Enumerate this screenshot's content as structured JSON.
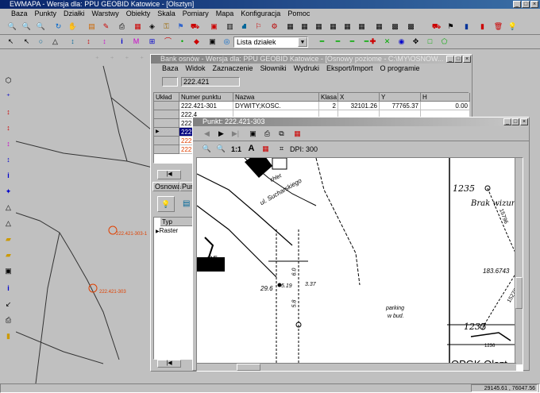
{
  "app": {
    "title": "EWMAPA - Wersja dla: PPU GEOBID Katowice - [Olsztyn]",
    "menu": [
      "Baza",
      "Punkty",
      "Działki",
      "Warstwy",
      "Obiekty",
      "Skala",
      "Pomiary",
      "Mapa",
      "Konfiguracja",
      "Pomoc"
    ],
    "layer_select": "Lista działek",
    "status_coords": "29145.61 , 76047.56"
  },
  "bank": {
    "title": "Bank osnów - Wersja dla: PPU GEOBID Katowice - [Osnowy poziome - C:\\MY\\OSNOW...",
    "menu": [
      "Baza",
      "Widok",
      "Zaznaczenie",
      "Słowniki",
      "Wydruki",
      "Eksport/Import",
      "O programie"
    ],
    "search_value": "222.421",
    "columns": [
      "Układ",
      "Numer punktu",
      "Nazwa",
      "Klasa",
      "X",
      "Y",
      "H"
    ],
    "rows": [
      {
        "num": "222.421-301",
        "name": "DYWITY;KOSC.",
        "klasa": "2",
        "x": "32101.26",
        "y": "77765.37",
        "h": "0.00"
      },
      {
        "num": "222.4",
        "name": "",
        "klasa": "",
        "x": "",
        "y": "",
        "h": ""
      },
      {
        "num": "222.4",
        "name": "",
        "klasa": "",
        "x": "",
        "y": "",
        "h": ""
      },
      {
        "num": "222.4",
        "name": "",
        "klasa": "",
        "x": "",
        "y": "",
        "h": ""
      },
      {
        "num": "222.4",
        "name": "",
        "klasa": "",
        "x": "",
        "y": "",
        "h": ""
      },
      {
        "num": "222.4",
        "name": "",
        "klasa": "",
        "x": "",
        "y": "",
        "h": ""
      }
    ],
    "tabs": [
      "Osnowa",
      "Pun"
    ],
    "sub_columns": [
      "Typ"
    ],
    "sub_rows": [
      "Raster"
    ]
  },
  "punkt": {
    "title": "Punkt: 222.421-303",
    "zoom_label": "1:1",
    "dpi": "DPI: 300",
    "scan_labels": {
      "s1235": "1235",
      "brak": "Brak wizur",
      "s1237": "1237",
      "opgk": "OPGK Olszt",
      "sucharskiego": "ul. Sucharskiego",
      "chlet": "chlet",
      "num05": "05",
      "v296": "29.6",
      "v519": "5.19",
      "v337": "3.37",
      "v58": "5.8",
      "v60": "6.0",
      "v1836743": "183.6743",
      "v15276": "15276",
      "v15796": "15796",
      "parking": "parking",
      "wbud": "w bud.",
      "num1236": "1236"
    }
  },
  "map": {
    "point1": "222.421-303-1",
    "point2": "222.421-303"
  }
}
